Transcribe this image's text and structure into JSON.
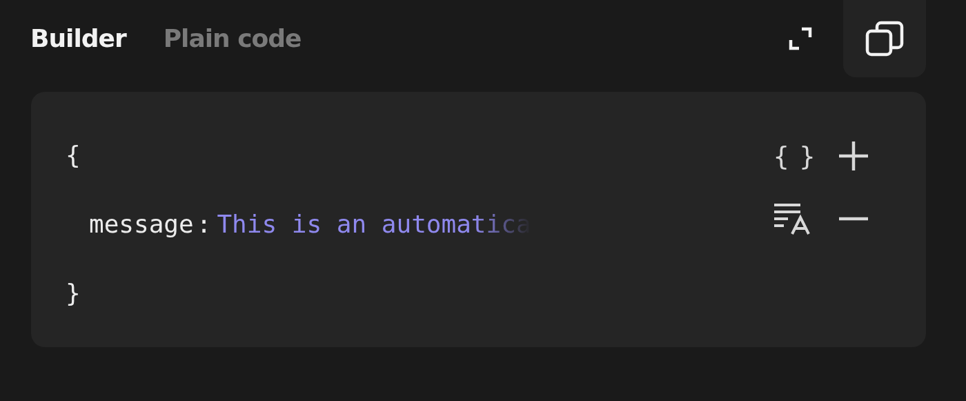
{
  "tabs": [
    {
      "label": "Builder",
      "selected": true
    },
    {
      "label": "Plain code",
      "selected": false
    }
  ],
  "editor": {
    "open_brace": "{",
    "close_brace": "}",
    "fields": [
      {
        "key": "message",
        "separator": ":",
        "value": "This is an automatica"
      }
    ],
    "braces_button": "{ }"
  }
}
